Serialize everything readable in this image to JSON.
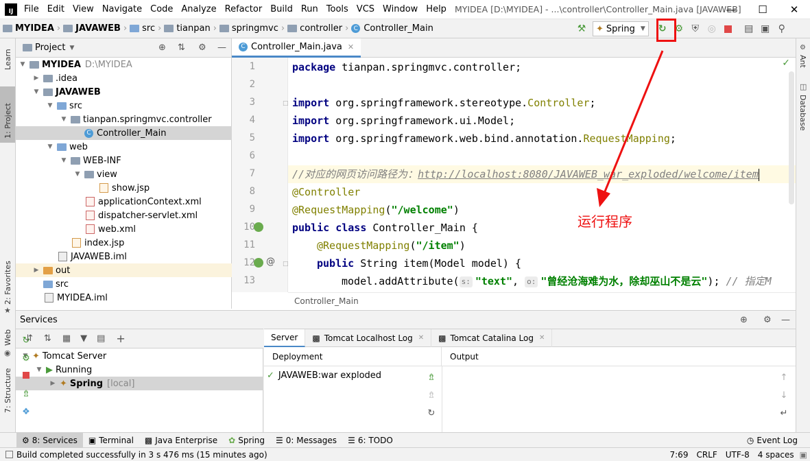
{
  "titlebar": {
    "logo": "IJ",
    "menu": [
      "File",
      "Edit",
      "View",
      "Navigate",
      "Code",
      "Analyze",
      "Refactor",
      "Build",
      "Run",
      "Tools",
      "VCS",
      "Window",
      "Help"
    ],
    "title": "MYIDEA [D:\\MYIDEA] - ...\\controller\\Controller_Main.java [JAVAWEB]"
  },
  "navbar": {
    "crumbs": [
      "MYIDEA",
      "JAVAWEB",
      "src",
      "tianpan",
      "springmvc",
      "controller",
      "Controller_Main"
    ],
    "run_config": "Spring"
  },
  "left_stripe": {
    "learn": "Learn",
    "project": "1: Project",
    "favorites": "2: Favorites",
    "web": "Web",
    "structure": "7: Structure"
  },
  "right_stripe": {
    "ant": "Ant",
    "database": "Database"
  },
  "project": {
    "header": "Project",
    "tree": [
      {
        "label": "MYIDEA",
        "extra": "D:\\MYIDEA"
      },
      {
        "label": ".idea"
      },
      {
        "label": "JAVAWEB"
      },
      {
        "label": "src"
      },
      {
        "label": "tianpan.springmvc.controller"
      },
      {
        "label": "Controller_Main"
      },
      {
        "label": "web"
      },
      {
        "label": "WEB-INF"
      },
      {
        "label": "view"
      },
      {
        "label": "show.jsp"
      },
      {
        "label": "applicationContext.xml"
      },
      {
        "label": "dispatcher-servlet.xml"
      },
      {
        "label": "web.xml"
      },
      {
        "label": "index.jsp"
      },
      {
        "label": "JAVAWEB.iml"
      },
      {
        "label": "out"
      },
      {
        "label": "src"
      },
      {
        "label": "MYIDEA.iml"
      }
    ]
  },
  "editor": {
    "tab": "Controller_Main.java",
    "line_numbers": [
      "1",
      "2",
      "3",
      "4",
      "5",
      "6",
      "7",
      "8",
      "9",
      "10",
      "11",
      "12",
      "13"
    ],
    "lines": {
      "l1_kw": "package",
      "l1_rest": " tianpan.springmvc.controller;",
      "l3_kw": "import",
      "l3_a": " org.springframework.stereotype.",
      "l3_b": "Controller",
      "l3_c": ";",
      "l4_kw": "import",
      "l4_a": " org.springframework.ui.Model;",
      "l5_kw": "import",
      "l5_a": " org.springframework.web.bind.annotation.",
      "l5_b": "RequestMapping",
      "l5_c": ";",
      "l7_cm": "//对应的网页访问路径为：",
      "l7_url": "http://localhost:8080/JAVAWEB_war_exploded/welcome/item",
      "l8_an": "@Controller",
      "l9_an": "@RequestMapping",
      "l9_a": "(",
      "l9_str": "\"/welcome\"",
      "l9_b": ")",
      "l10_kw": "public class",
      "l10_a": " Controller_Main {",
      "l11_an": "@RequestMapping",
      "l11_a": "(",
      "l11_str": "\"/item\"",
      "l11_b": ")",
      "l12_kw": "public",
      "l12_a": " String item(Model model) {",
      "l13_a": "model.addAttribute(",
      "l13_h1": "s:",
      "l13_str1": "\"text\"",
      "l13_b": ", ",
      "l13_h2": "o:",
      "l13_str2": "\"曾经沧海难为水，除却巫山不是云\"",
      "l13_c": "); ",
      "l13_cm": "// 指定M"
    },
    "breadcrumb": "Controller_Main"
  },
  "services": {
    "title": "Services",
    "tree": {
      "tomcat": "Tomcat Server",
      "running": "Running",
      "spring": "Spring",
      "spring_extra": "[local]"
    },
    "tabs": [
      "Server",
      "Tomcat Localhost Log",
      "Tomcat Catalina Log"
    ],
    "deployment_header": "Deployment",
    "output_header": "Output",
    "deployment_item": "JAVAWEB:war exploded"
  },
  "toolwindows": {
    "services": "8: Services",
    "terminal": "Terminal",
    "java_enterprise": "Java Enterprise",
    "spring": "Spring",
    "messages": "0: Messages",
    "todo": "6: TODO",
    "event_log": "Event Log"
  },
  "status": {
    "message": "Build completed successfully in 3 s 476 ms (15 minutes ago)",
    "position": "7:69",
    "line_sep": "CRLF",
    "encoding": "UTF-8",
    "indent": "4 spaces"
  },
  "annotation": {
    "text": "运行程序",
    "color": "#ee1111"
  },
  "colors": {
    "keyword": "#000080",
    "annotation": "#808000",
    "string": "#008000",
    "comment": "#808080",
    "selection": "#d5d5d5"
  }
}
